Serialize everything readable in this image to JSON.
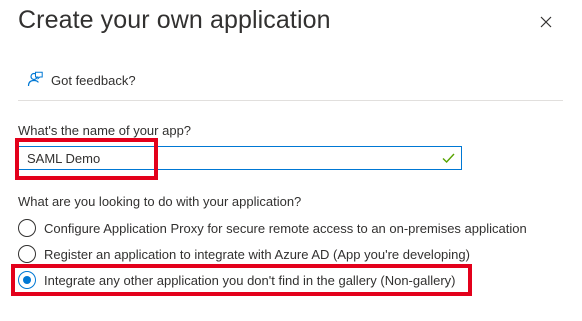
{
  "panel": {
    "title": "Create your own application",
    "close_icon": "close-icon"
  },
  "feedback": {
    "icon": "feedback-icon",
    "label": "Got feedback?"
  },
  "app_name": {
    "label": "What's the name of your app?",
    "value": "SAML Demo",
    "valid": true,
    "valid_icon": "checkmark-icon"
  },
  "purpose": {
    "question": "What are you looking to do with your application?",
    "options": [
      {
        "label": "Configure Application Proxy for secure remote access to an on-premises application",
        "selected": false
      },
      {
        "label": "Register an application to integrate with Azure AD (App you're developing)",
        "selected": false
      },
      {
        "label": "Integrate any other application you don't find in the gallery (Non-gallery)",
        "selected": true
      }
    ]
  },
  "colors": {
    "accent": "#0078d4",
    "valid": "#57a300",
    "highlight": "#e3001b",
    "text": "#323130"
  }
}
